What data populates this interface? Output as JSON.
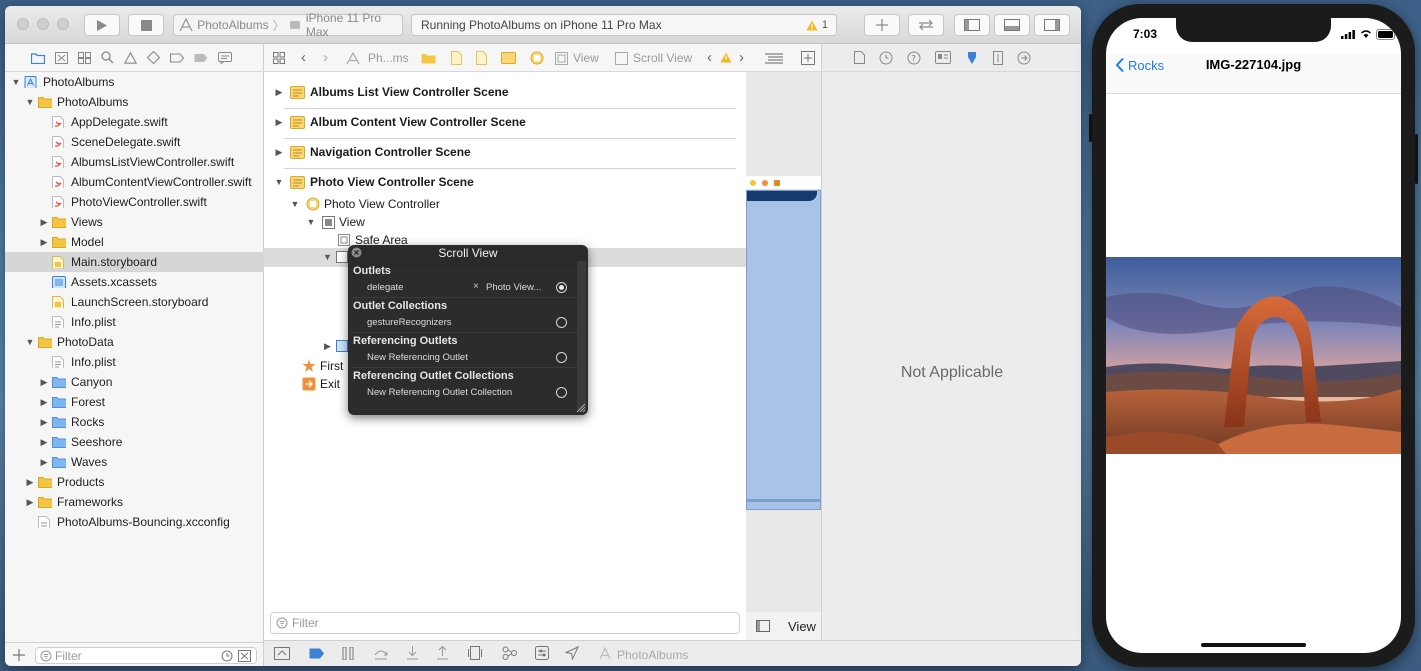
{
  "toolbar": {
    "scheme_app": "PhotoAlbums",
    "scheme_device": "iPhone 11 Pro Max",
    "status_text": "Running PhotoAlbums on iPhone 11 Pro Max",
    "warning_count": "1"
  },
  "navigator": {
    "items": [
      {
        "label": "PhotoAlbums",
        "kind": "project",
        "indent": 0,
        "expanded": "▼"
      },
      {
        "label": "PhotoAlbums",
        "kind": "folder",
        "indent": 1,
        "expanded": "▼"
      },
      {
        "label": "AppDelegate.swift",
        "kind": "swift",
        "indent": 2,
        "expanded": ""
      },
      {
        "label": "SceneDelegate.swift",
        "kind": "swift",
        "indent": 2,
        "expanded": ""
      },
      {
        "label": "AlbumsListViewController.swift",
        "kind": "swift",
        "indent": 2,
        "expanded": ""
      },
      {
        "label": "AlbumContentViewController.swift",
        "kind": "swift",
        "indent": 2,
        "expanded": ""
      },
      {
        "label": "PhotoViewController.swift",
        "kind": "swift",
        "indent": 2,
        "expanded": ""
      },
      {
        "label": "Views",
        "kind": "folder",
        "indent": 2,
        "expanded": "▶"
      },
      {
        "label": "Model",
        "kind": "folder",
        "indent": 2,
        "expanded": "▶"
      },
      {
        "label": "Main.storyboard",
        "kind": "storyboard",
        "indent": 2,
        "expanded": "",
        "selected": true
      },
      {
        "label": "Assets.xcassets",
        "kind": "assets",
        "indent": 2,
        "expanded": ""
      },
      {
        "label": "LaunchScreen.storyboard",
        "kind": "storyboard",
        "indent": 2,
        "expanded": ""
      },
      {
        "label": "Info.plist",
        "kind": "plist",
        "indent": 2,
        "expanded": ""
      },
      {
        "label": "PhotoData",
        "kind": "folder",
        "indent": 1,
        "expanded": "▼"
      },
      {
        "label": "Info.plist",
        "kind": "plist",
        "indent": 2,
        "expanded": ""
      },
      {
        "label": "Canyon",
        "kind": "bluefolder",
        "indent": 2,
        "expanded": "▶"
      },
      {
        "label": "Forest",
        "kind": "bluefolder",
        "indent": 2,
        "expanded": "▶"
      },
      {
        "label": "Rocks",
        "kind": "bluefolder",
        "indent": 2,
        "expanded": "▶"
      },
      {
        "label": "Seeshore",
        "kind": "bluefolder",
        "indent": 2,
        "expanded": "▶"
      },
      {
        "label": "Waves",
        "kind": "bluefolder",
        "indent": 2,
        "expanded": "▶"
      },
      {
        "label": "Products",
        "kind": "folder",
        "indent": 1,
        "expanded": "▶"
      },
      {
        "label": "Frameworks",
        "kind": "folder",
        "indent": 1,
        "expanded": "▶"
      },
      {
        "label": "PhotoAlbums-Bouncing.xcconfig",
        "kind": "config",
        "indent": 1,
        "expanded": ""
      }
    ],
    "filter_placeholder": "Filter"
  },
  "jumpbar": {
    "crumb_project": "Ph...ms",
    "crumb_view": "View",
    "crumb_scroll": "Scroll View"
  },
  "outline": {
    "scenes": [
      "Albums List View Controller Scene",
      "Album Content View Controller Scene",
      "Navigation Controller Scene",
      "Photo View Controller Scene"
    ],
    "photo_vc": "Photo View Controller",
    "view": "View",
    "safe_area": "Safe Area",
    "first_responder": "First",
    "exit": "Exit",
    "filter_placeholder": "Filter"
  },
  "popup": {
    "title": "Scroll View",
    "sections": [
      {
        "header": "Outlets",
        "items": [
          {
            "name": "delegate",
            "target": "Photo View...",
            "connected": true
          }
        ]
      },
      {
        "header": "Outlet Collections",
        "items": [
          {
            "name": "gestureRecognizers",
            "target": "",
            "connected": false
          }
        ]
      },
      {
        "header": "Referencing Outlets",
        "items": [
          {
            "name": "New Referencing Outlet",
            "target": "",
            "connected": false
          }
        ]
      },
      {
        "header": "Referencing Outlet Collections",
        "items": [
          {
            "name": "New Referencing Outlet Collection",
            "target": "",
            "connected": false
          }
        ]
      }
    ]
  },
  "canvas": {
    "bottom_label": "View"
  },
  "inspector": {
    "message": "Not Applicable"
  },
  "bottombar": {
    "target_label": "PhotoAlbums"
  },
  "simulator": {
    "time": "7:03",
    "back_label": "Rocks",
    "title": "IMG-227104.jpg"
  },
  "colors": {
    "accent": "#1f7cf0",
    "folder": "#f4c542",
    "selection": "#d6d6d6"
  }
}
